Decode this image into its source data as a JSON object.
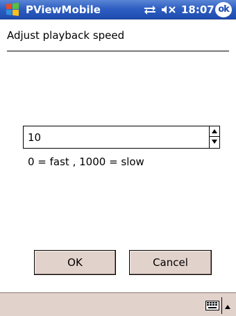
{
  "titlebar": {
    "app_title": "PViewMobile",
    "clock": "18:07",
    "ok_label": "ok",
    "icons": [
      "windows-start-icon",
      "connectivity-icon",
      "volume-icon",
      "ok-icon"
    ]
  },
  "dialog": {
    "header": "Adjust playback speed",
    "speed": {
      "value": "10",
      "hint": "0 = fast ,  1000 = slow"
    },
    "buttons": {
      "ok": "OK",
      "cancel": "Cancel"
    }
  },
  "menubar": {
    "icons": [
      "keyboard-icon",
      "sip-arrow-icon"
    ]
  },
  "colors": {
    "titlebar": "#2f5fc2",
    "button_face": "#e2d2cc",
    "background": "#ffffff"
  }
}
